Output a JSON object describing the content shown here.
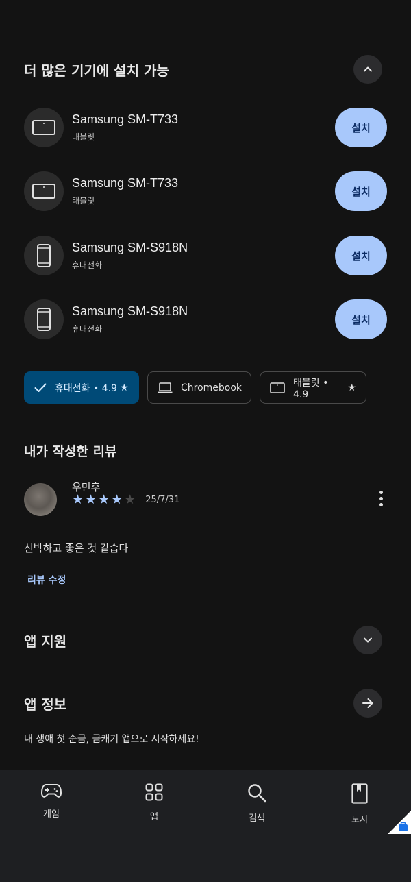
{
  "install_section": {
    "title": "더 많은 기기에 설치 가능",
    "devices": [
      {
        "name": "Samsung SM-T733",
        "type": "태블릿",
        "kind": "tablet",
        "button": "설치"
      },
      {
        "name": "Samsung SM-T733",
        "type": "태블릿",
        "kind": "tablet",
        "button": "설치"
      },
      {
        "name": "Samsung SM-S918N",
        "type": "휴대전화",
        "kind": "phone",
        "button": "설치"
      },
      {
        "name": "Samsung SM-S918N",
        "type": "휴대전화",
        "kind": "phone",
        "button": "설치"
      }
    ]
  },
  "chips": [
    {
      "label": "휴대전화 • 4.9",
      "icon": "check-icon",
      "star": true,
      "selected": true
    },
    {
      "label": "Chromebook",
      "icon": "laptop-icon",
      "star": false,
      "selected": false
    },
    {
      "label": "태블릿 • 4.9",
      "icon": "tablet-icon",
      "star": true,
      "selected": false
    }
  ],
  "my_review": {
    "title": "내가 작성한 리뷰",
    "reviewer": "우민후",
    "rating": 4,
    "max_rating": 5,
    "date": "25/7/31",
    "text": "신박하고 좋은 것 같습다",
    "edit_link": "리뷰 수정"
  },
  "app_support": {
    "title": "앱 지원"
  },
  "app_info": {
    "title": "앱 정보",
    "description": "내 생애 첫 순금, 금캐기 앱으로 시작하세요!"
  },
  "bottom_nav": [
    {
      "label": "게임",
      "icon": "gamepad-icon"
    },
    {
      "label": "앱",
      "icon": "apps-grid-icon"
    },
    {
      "label": "검색",
      "icon": "search-icon"
    },
    {
      "label": "도서",
      "icon": "book-icon"
    }
  ],
  "colors": {
    "background": "#131313",
    "accent": "#a8c8fb",
    "selected_chip": "#004a77",
    "nav_background": "#1e1f22"
  }
}
